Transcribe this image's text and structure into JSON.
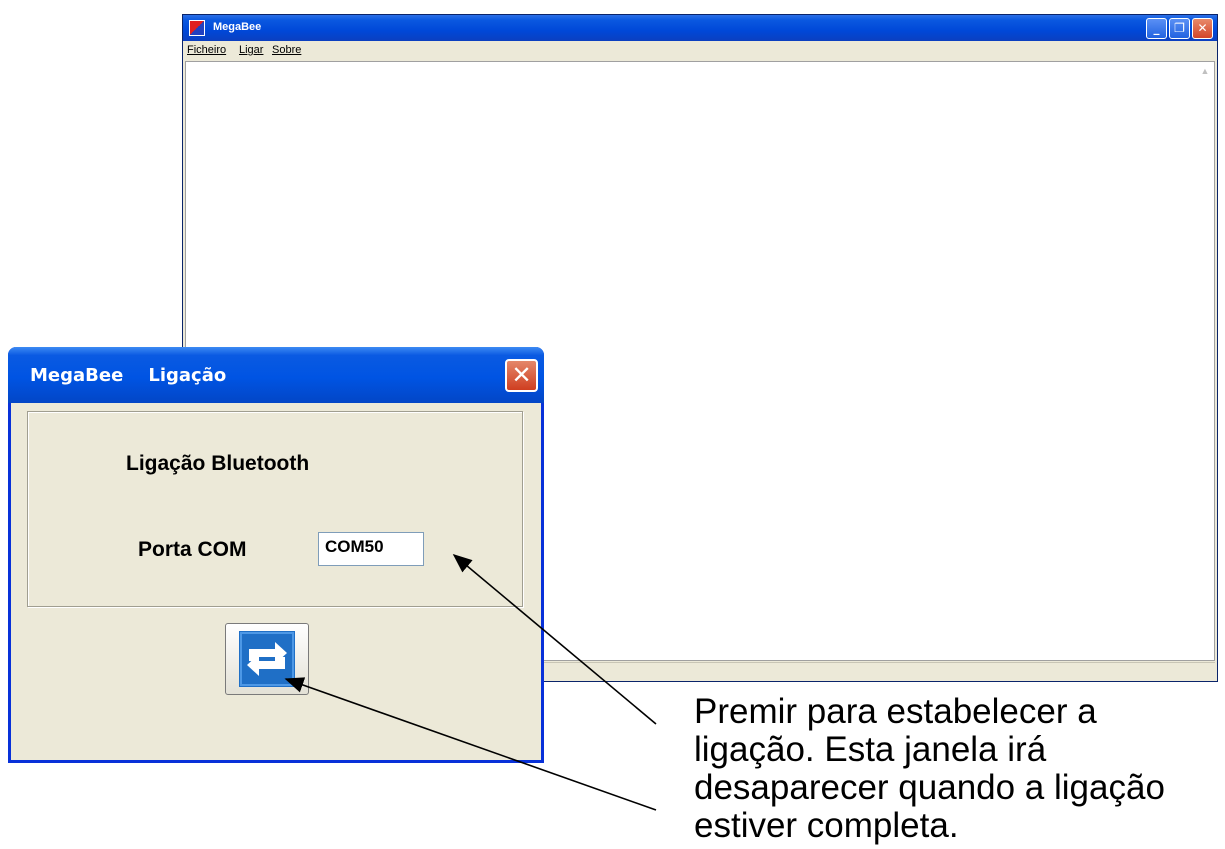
{
  "main_window": {
    "title": "MegaBee",
    "menu": [
      "Ficheiro",
      "Ligar",
      "Sobre"
    ]
  },
  "dialog": {
    "title": "MegaBee    Ligação",
    "bluetooth_label": "Ligação Bluetooth",
    "port_label": "Porta COM",
    "port_value": "COM50"
  },
  "annotation": {
    "line1": "Premir para estabelecer a",
    "line2": "ligação. Esta janela irá",
    "line3": "desaparecer quando a ligação",
    "line4": "estiver completa."
  }
}
